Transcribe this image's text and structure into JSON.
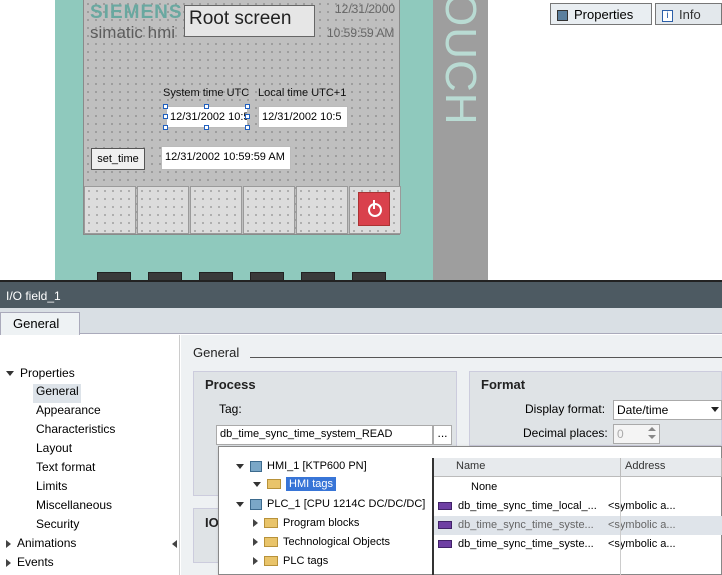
{
  "hmi": {
    "brand": "SIEMENS",
    "product": "simatic hmi",
    "screen_title": "Root screen",
    "header_date": "12/31/2000",
    "header_time": "10:59:59 AM",
    "label_utc": "System time UTC",
    "label_local": "Local time UTC+1",
    "field_utc": "12/31/2002 10:5",
    "field_local": "12/31/2002 10:5",
    "set_time_label": "set_time",
    "field_set_time": "12/31/2002 10:59:59 AM",
    "side_text": "OUCH"
  },
  "inspector": {
    "object_title": "I/O field_1",
    "tab_properties": "Properties",
    "tab_info": "Info",
    "tab_general": "General",
    "nav": [
      {
        "label": "Properties",
        "expanded": true
      },
      {
        "label": "General",
        "selected": true
      },
      {
        "label": "Appearance"
      },
      {
        "label": "Characteristics"
      },
      {
        "label": "Layout"
      },
      {
        "label": "Text format"
      },
      {
        "label": "Limits"
      },
      {
        "label": "Miscellaneous"
      },
      {
        "label": "Security"
      },
      {
        "label": "Animations",
        "expanded": false
      },
      {
        "label": "Events",
        "expanded": false
      }
    ],
    "section_title": "General",
    "process": {
      "title": "Process",
      "tag_label": "Tag:",
      "tag_value": "db_time_sync_time_system_READ",
      "browse": "..."
    },
    "format": {
      "title": "Format",
      "display_format_label": "Display format:",
      "display_format_value": "Date/time",
      "decimal_places_label": "Decimal places:",
      "decimal_places_value": "0"
    },
    "io_partial": "IO"
  },
  "tag_picker": {
    "tree": [
      {
        "label": "HMI_1 [KTP600 PN]"
      },
      {
        "label": "HMI tags"
      },
      {
        "label": "PLC_1 [CPU 1214C DC/DC/DC]"
      },
      {
        "label": "Program blocks"
      },
      {
        "label": "Technological Objects"
      },
      {
        "label": "PLC tags"
      }
    ],
    "columns": {
      "name": "Name",
      "address": "Address"
    },
    "rows": [
      {
        "name": "None",
        "address": ""
      },
      {
        "name": "db_time_sync_time_local_...",
        "address": "<symbolic a..."
      },
      {
        "name": "db_time_sync_time_syste...",
        "address": "<symbolic a..."
      },
      {
        "name": "db_time_sync_time_syste...",
        "address": "<symbolic a..."
      }
    ]
  }
}
